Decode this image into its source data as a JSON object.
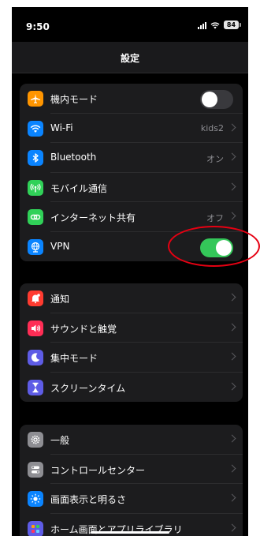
{
  "status": {
    "time": "9:50",
    "battery": "84"
  },
  "nav": {
    "title": "設定"
  },
  "groups": [
    {
      "rows": [
        {
          "label": "機内モード",
          "icon": "airplane-icon",
          "icon_color": "#ff9500",
          "control": "toggle",
          "state": "off"
        },
        {
          "label": "Wi-Fi",
          "icon": "wifi-icon",
          "icon_color": "#0a84ff",
          "value": "kids2"
        },
        {
          "label": "Bluetooth",
          "icon": "bluetooth-icon",
          "icon_color": "#0a84ff",
          "value": "オン"
        },
        {
          "label": "モバイル通信",
          "icon": "antenna-icon",
          "icon_color": "#30d158"
        },
        {
          "label": "インターネット共有",
          "icon": "link-icon",
          "icon_color": "#30d158",
          "value": "オフ"
        },
        {
          "label": "VPN",
          "icon": "globe-icon",
          "icon_color": "#0a84ff",
          "control": "toggle",
          "state": "on"
        }
      ]
    },
    {
      "rows": [
        {
          "label": "通知",
          "icon": "bell-icon",
          "icon_color": "#ff3b30"
        },
        {
          "label": "サウンドと触覚",
          "icon": "speaker-icon",
          "icon_color": "#ff2d55"
        },
        {
          "label": "集中モード",
          "icon": "moon-icon",
          "icon_color": "#5e5ce6"
        },
        {
          "label": "スクリーンタイム",
          "icon": "hourglass-icon",
          "icon_color": "#5e5ce6"
        }
      ]
    },
    {
      "rows": [
        {
          "label": "一般",
          "icon": "gear-icon",
          "icon_color": "#8e8e93"
        },
        {
          "label": "コントロールセンター",
          "icon": "switches-icon",
          "icon_color": "#8e8e93"
        },
        {
          "label": "画面表示と明るさ",
          "icon": "sun-icon",
          "icon_color": "#0a84ff"
        },
        {
          "label": "ホーム画面とアプリライブラリ",
          "icon": "grid-icon",
          "icon_color": "#5e5ce6"
        }
      ]
    }
  ],
  "colors": {
    "background": "#000000",
    "group": "#1c1c1e",
    "toggle_on": "#34c759",
    "highlight": "#e60012"
  }
}
